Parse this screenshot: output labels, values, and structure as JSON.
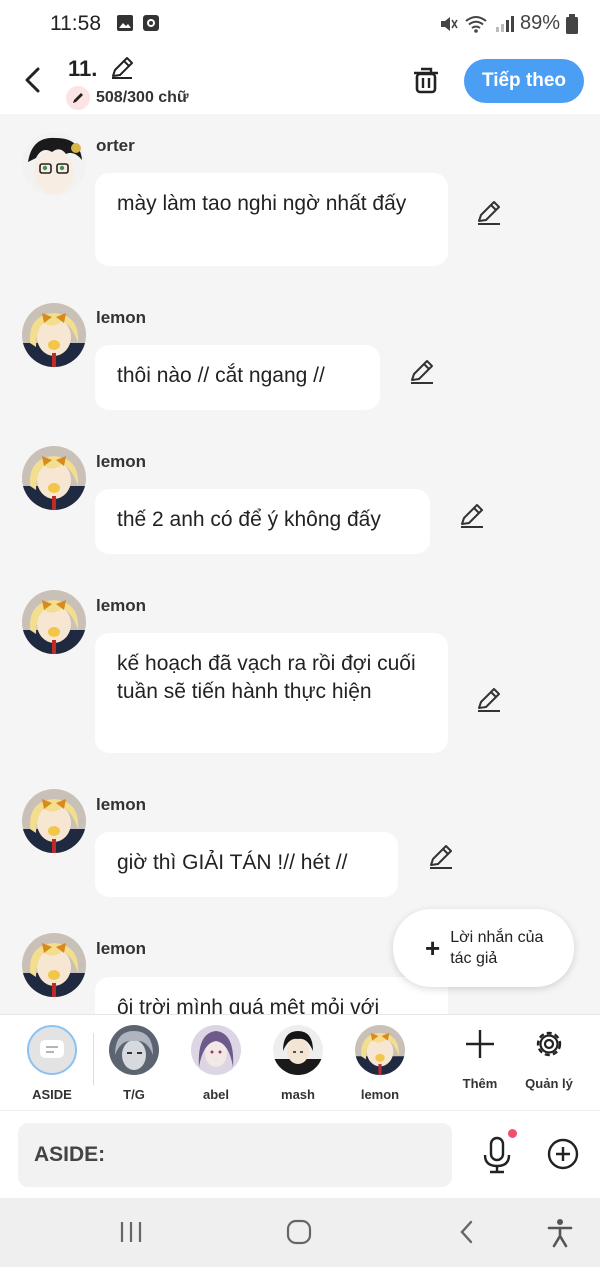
{
  "status": {
    "time": "11:58",
    "battery": "89%"
  },
  "header": {
    "title": "11.",
    "word_count": "508/300 chữ",
    "next_label": "Tiếp theo"
  },
  "messages": [
    {
      "sender": "orter",
      "text": "mày làm tao nghi ngờ nhất đấy"
    },
    {
      "sender": "lemon",
      "text": "thôi nào // cắt ngang //"
    },
    {
      "sender": "lemon",
      "text": "thế 2 anh có để ý không đấy"
    },
    {
      "sender": "lemon",
      "text": "kế hoạch đã vạch ra rồi đợi cuối tuần sẽ tiến hành thực hiện"
    },
    {
      "sender": "lemon",
      "text": "giờ thì GIẢI TÁN !// hét //"
    },
    {
      "sender": "lemon",
      "text": "ôi trời mình quá mệt mỏi với"
    }
  ],
  "author_note": {
    "label": "Lời nhắn của tác giả"
  },
  "characters": [
    {
      "name": "ASIDE"
    },
    {
      "name": "T/G"
    },
    {
      "name": "abel"
    },
    {
      "name": "mash"
    },
    {
      "name": "lemon"
    }
  ],
  "tools": {
    "add_label": "Thêm",
    "manage_label": "Quản lý"
  },
  "input": {
    "placeholder": "ASIDE:"
  },
  "colors": {
    "accent": "#4a9ff5",
    "background": "#f5f5f5",
    "bubble": "#ffffff"
  }
}
